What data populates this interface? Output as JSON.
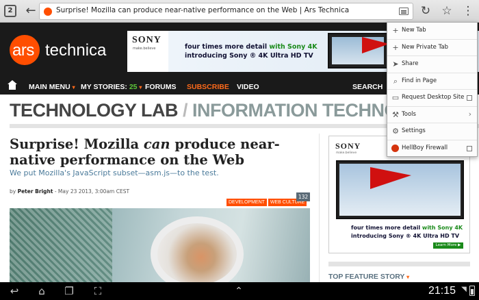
{
  "browser": {
    "tabs_count": "2",
    "url_title": "Surprise! Mozilla can produce near-native performance on the Web | Ars Technica",
    "icons": {
      "back": "back-arrow-icon",
      "reload": "reload-icon",
      "bookmark": "star-icon",
      "menu": "overflow-menu-icon",
      "reader": "reader-mode-icon"
    }
  },
  "site": {
    "logo_ars": "ars",
    "logo_tech": "technica",
    "brand_color": "#ff4e00",
    "banner": {
      "brand": "SONY",
      "tagline": "make.believe",
      "line1_a": "four times more detail ",
      "line1_b": "with Sony 4K",
      "line2": "introducing Sony ® 4K Ultra HD TV"
    }
  },
  "nav": {
    "main_menu": "MAIN MENU",
    "my_stories": "MY STORIES:",
    "my_stories_count": "25",
    "forums": "FORUMS",
    "subscribe": "SUBSCRIBE",
    "video": "VIDEO",
    "search": "SEARCH"
  },
  "section": {
    "main": "TECHNOLOGY LAB",
    "sep": " / ",
    "sub": "INFORMATION TECHNOLOGY"
  },
  "article": {
    "title_before": "Surprise! Mozilla ",
    "title_em": "can",
    "title_after": " produce near-native performance on the Web",
    "subtitle": "We put Mozilla's JavaScript subset—asm.js—to the test.",
    "by": "by ",
    "author": "Peter Bright",
    "date": " - May 23 2013, 3:00am CEST",
    "tags": [
      "DEVELOPMENT",
      "WEB CULTURE"
    ],
    "comments": "132"
  },
  "sidebar": {
    "ad": {
      "brand": "SONY",
      "tagline": "make.believe",
      "line1_a": "four times more detail ",
      "line1_b": "with Sony 4K",
      "line2": "introducing Sony ® 4K Ultra HD TV",
      "cta": "Learn More ▶"
    },
    "feature_heading": "TOP FEATURE STORY"
  },
  "menu": {
    "items": [
      {
        "label": "New Tab",
        "icon": "plus-icon"
      },
      {
        "label": "New Private Tab",
        "icon": "private-tab-icon"
      },
      {
        "label": "Share",
        "icon": "share-icon"
      },
      {
        "label": "Find in Page",
        "icon": "search-icon"
      },
      {
        "label": "Request Desktop Site",
        "icon": "desktop-icon"
      },
      {
        "label": "Tools",
        "icon": "tools-icon"
      },
      {
        "label": "Settings",
        "icon": "gear-icon"
      },
      {
        "label": "HellBoy Firewall",
        "icon": "firewall-icon"
      }
    ]
  },
  "system": {
    "time": "21:15"
  }
}
